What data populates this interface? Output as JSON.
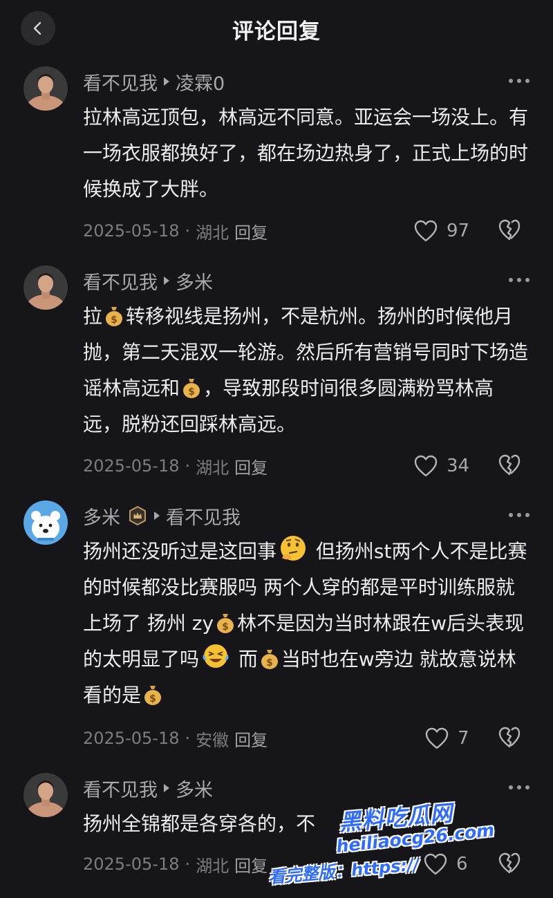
{
  "header": {
    "title": "评论回复"
  },
  "colors": {
    "background": "#16161a",
    "text": "#ececec",
    "secondary": "#a9a9ad",
    "meta": "#7c7c82",
    "watermark": "#2f6bff"
  },
  "comments": [
    {
      "author": "看不见我",
      "reply_to": "凌霖0",
      "segments": [
        "拉林高远顶包，林高远不同意。亚运会一场没上。有一场衣服都换好了，都在场边热身了，正式上场的时候换成了大胖。"
      ],
      "date": "2025-05-18",
      "separator": "·",
      "location": "湖北",
      "reply_label": "回复",
      "likes": "97",
      "avatar_icon": "man-portrait-avatar-icon"
    },
    {
      "author": "看不见我",
      "reply_to": "多米",
      "segments": [
        "拉",
        "转移视线是扬州，不是杭州。扬州的时候他月抛，第二天混双一轮游。然后所有营销号同时下场造谣林高远和",
        "，导致那段时间很多圆满粉骂林高远，脱粉还回踩林高远。"
      ],
      "date": "2025-05-18",
      "separator": "·",
      "location": "湖北",
      "reply_label": "回复",
      "likes": "34",
      "avatar_icon": "man-portrait-avatar-icon"
    },
    {
      "author": "多米",
      "reply_to": "看不见我",
      "segments": [
        "扬州还没听过是这回事",
        " 但扬州st两个人不是比赛的时候都没比赛服吗  两个人穿的都是平时训练服就上场了  扬州 zy",
        "林不是因为当时林跟在w后头表现的太明显了吗",
        " 而",
        "当时也在w旁边   就故意说林看的是"
      ],
      "date": "2025-05-18",
      "separator": "·",
      "location": "安徽",
      "reply_label": "回复",
      "likes": "7",
      "avatar_icon": "white-bear-avatar-icon"
    },
    {
      "author": "看不见我",
      "reply_to": "多米",
      "segments": [
        "扬州全锦都是各穿各的，不"
      ],
      "date": "2025-05-18",
      "separator": "·",
      "location": "湖北",
      "reply_label": "回复",
      "likes": "6",
      "avatar_icon": "man-portrait-avatar-icon"
    }
  ],
  "watermark": {
    "brand": "黑料吃瓜网",
    "url": "heiliaocg26.com",
    "label": "看完整版：https://"
  }
}
